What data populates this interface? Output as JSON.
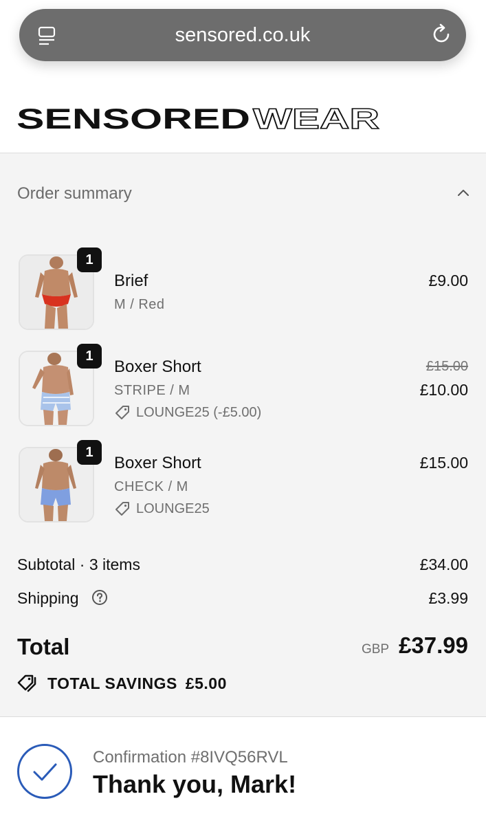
{
  "browser": {
    "url": "sensored.co.uk",
    "reader_icon": "reader-icon",
    "reload_icon": "reload-icon"
  },
  "brand": {
    "name_bold": "SENSORED",
    "name_outline": "WEAR"
  },
  "summary": {
    "label": "Order summary",
    "toggle_icon": "chevron-up-icon"
  },
  "items": [
    {
      "qty": "1",
      "name": "Brief",
      "variant": "M / Red",
      "price": "£9.00",
      "original_price": "",
      "discount": "",
      "swatch": "#d8321f"
    },
    {
      "qty": "1",
      "name": "Boxer Short",
      "variant": "STRIPE / M",
      "price": "£10.00",
      "original_price": "£15.00",
      "discount": "LOUNGE25 (-£5.00)",
      "swatch": "#a9c3ea"
    },
    {
      "qty": "1",
      "name": "Boxer Short",
      "variant": "CHECK / M",
      "price": "£15.00",
      "original_price": "",
      "discount": "LOUNGE25",
      "swatch": "#7f9fe0"
    }
  ],
  "totals": {
    "subtotal_label": "Subtotal · 3 items",
    "subtotal_value": "£34.00",
    "shipping_label": "Shipping",
    "shipping_value": "£3.99",
    "total_label": "Total",
    "currency": "GBP",
    "total_value": "£37.99",
    "savings_label": "TOTAL SAVINGS",
    "savings_value": "£5.00"
  },
  "confirmation": {
    "number": "Confirmation #8IVQ56RVL",
    "thanks": "Thank you, Mark!"
  },
  "colors": {
    "panel_bg": "#f4f4f4",
    "accent_blue": "#2a5bb8",
    "urlbar_bg": "#6d6d6d"
  }
}
